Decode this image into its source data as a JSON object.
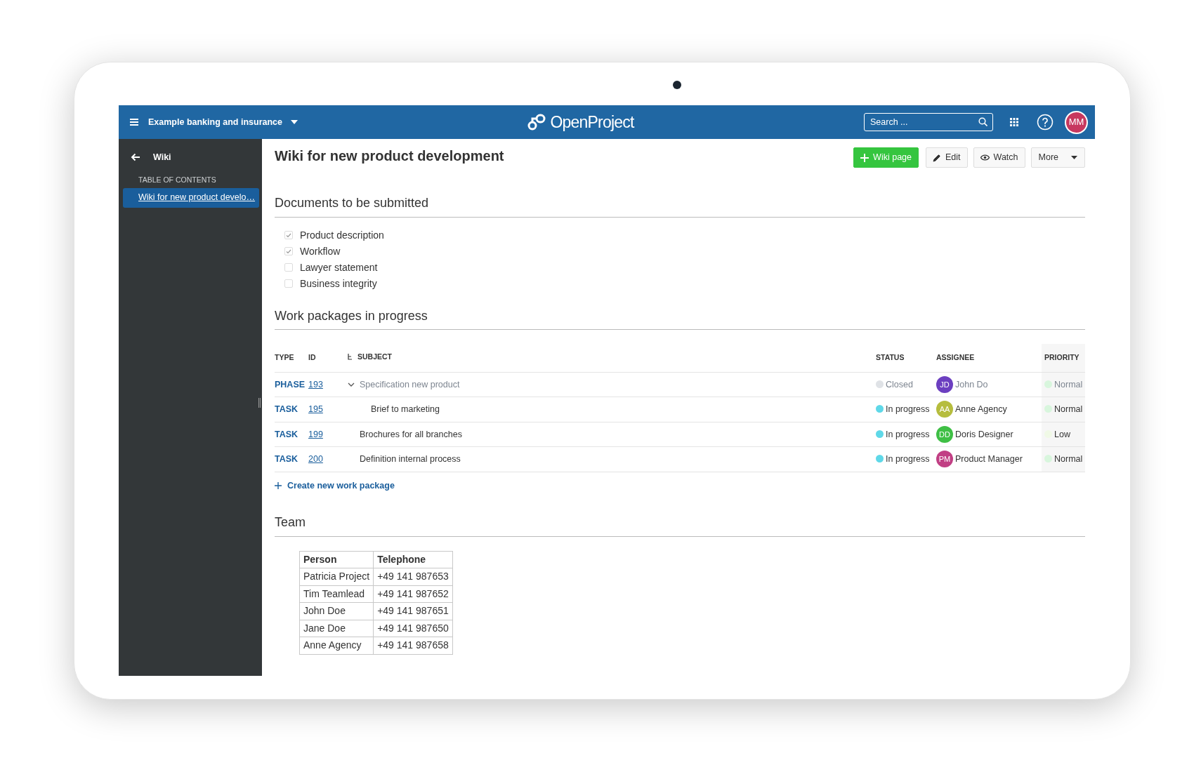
{
  "header": {
    "project": "Example banking and insurance",
    "logo": "OpenProject",
    "search": {
      "placeholder": "Search ..."
    },
    "avatar": "MM"
  },
  "sidebar": {
    "back_label": "Wiki",
    "toc_heading": "TABLE OF CONTENTS",
    "items": [
      {
        "label": "Wiki for new product develo…",
        "selected": true
      }
    ]
  },
  "page": {
    "title": "Wiki for new product development",
    "buttons": [
      {
        "kind": "add",
        "label": "Wiki page"
      },
      {
        "kind": "edit",
        "label": "Edit"
      },
      {
        "kind": "watch",
        "label": "Watch"
      },
      {
        "kind": "more",
        "label": "More"
      }
    ]
  },
  "documents": {
    "heading": "Documents to be submitted",
    "items": [
      {
        "label": "Product description",
        "checked": true
      },
      {
        "label": "Workflow",
        "checked": true
      },
      {
        "label": "Lawyer statement",
        "checked": false
      },
      {
        "label": "Business integrity",
        "checked": false
      }
    ]
  },
  "work_packages": {
    "heading": "Work packages in progress",
    "columns": [
      "TYPE",
      "ID",
      "SUBJECT",
      "STATUS",
      "ASSIGNEE",
      "PRIORITY"
    ],
    "rows": [
      {
        "type": "PHASE",
        "id": "193",
        "subject": "Specification new product",
        "closed": true,
        "expanded": true,
        "status": {
          "label": "Closed",
          "color": "#dfe2e6"
        },
        "assignee": {
          "initials": "JD",
          "name": "John Do",
          "color": "#6c3fc0"
        },
        "priority": {
          "label": "Normal",
          "color": "#d8f6dd"
        },
        "children": [
          {
            "type": "TASK",
            "id": "195",
            "subject": "Brief to marketing",
            "closed": false,
            "status": {
              "label": "In progress",
              "color": "#5fd8e8"
            },
            "assignee": {
              "initials": "AA",
              "name": "Anne Agency",
              "color": "#b6bd3e"
            },
            "priority": {
              "label": "Normal",
              "color": "#d8f6dd"
            }
          }
        ]
      },
      {
        "type": "TASK",
        "id": "199",
        "subject": "Brochures for all branches",
        "closed": false,
        "status": {
          "label": "In progress",
          "color": "#5fd8e8"
        },
        "assignee": {
          "initials": "DD",
          "name": "Doris Designer",
          "color": "#3fbf45"
        },
        "priority": {
          "label": "Low",
          "color": "#f0f9e6"
        }
      },
      {
        "type": "TASK",
        "id": "200",
        "subject": "Definition internal process",
        "closed": false,
        "status": {
          "label": "In progress",
          "color": "#5fd8e8"
        },
        "assignee": {
          "initials": "PM",
          "name": "Product Manager",
          "color": "#c13f84"
        },
        "priority": {
          "label": "Normal",
          "color": "#d8f6dd"
        }
      }
    ],
    "create_link": "Create new work package"
  },
  "team": {
    "heading": "Team",
    "columns": [
      "Person",
      "Telephone"
    ],
    "rows": [
      [
        "Patricia Project",
        "+49 141 987653"
      ],
      [
        "Tim Teamlead",
        "+49 141 987652"
      ],
      [
        "John Doe",
        "+49 141 987651"
      ],
      [
        "Jane Doe",
        "+49 141 987650"
      ],
      [
        "Anne Agency",
        "+49 141 987658"
      ]
    ]
  }
}
